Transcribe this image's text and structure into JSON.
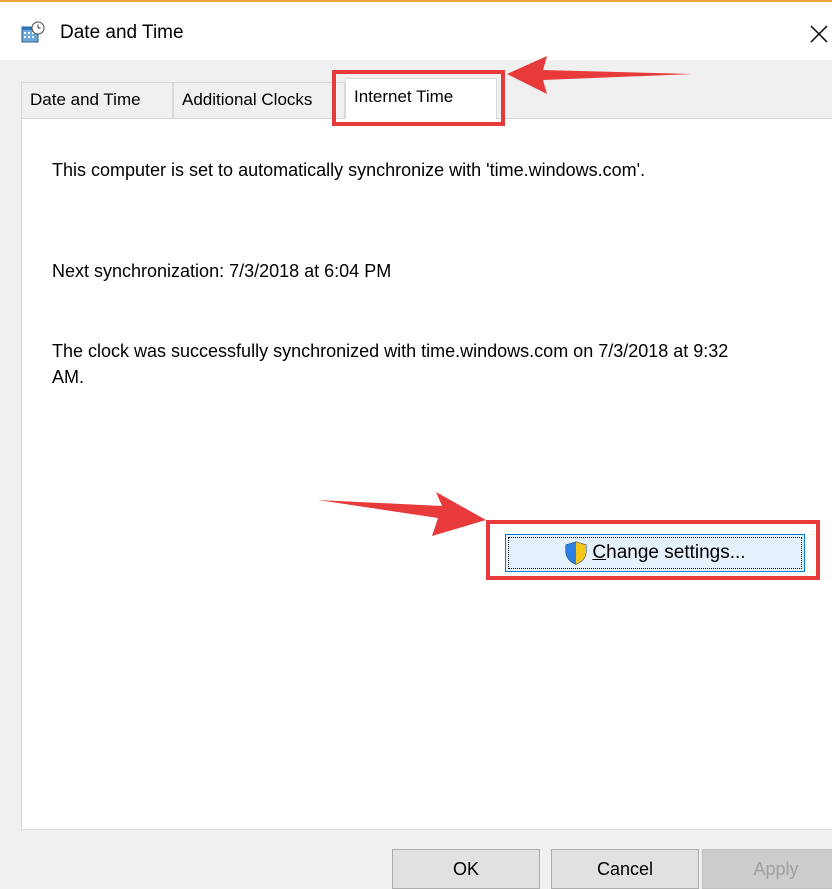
{
  "window": {
    "title": "Date and Time",
    "icon": "date-time-icon",
    "close_icon": "close-icon"
  },
  "tabs": [
    {
      "label": "Date and Time",
      "selected": false
    },
    {
      "label": "Additional Clocks",
      "selected": false
    },
    {
      "label": "Internet Time",
      "selected": true
    }
  ],
  "internet_time": {
    "sync_info": "This computer is set to automatically synchronize with 'time.windows.com'.",
    "next_sync": "Next synchronization: 7/3/2018 at 6:04 PM",
    "last_sync": "The clock was successfully synchronized with time.windows.com on 7/3/2018 at 9:32 AM.",
    "change_settings": {
      "mnemonic": "C",
      "rest": "hange settings...",
      "icon": "uac-shield-icon"
    }
  },
  "footer": {
    "ok": "OK",
    "cancel": "Cancel",
    "apply": "Apply"
  },
  "colors": {
    "annotation_red": "#e83a3a",
    "focus_blue": "#0078d7",
    "title_accent": "#f0a33a"
  }
}
